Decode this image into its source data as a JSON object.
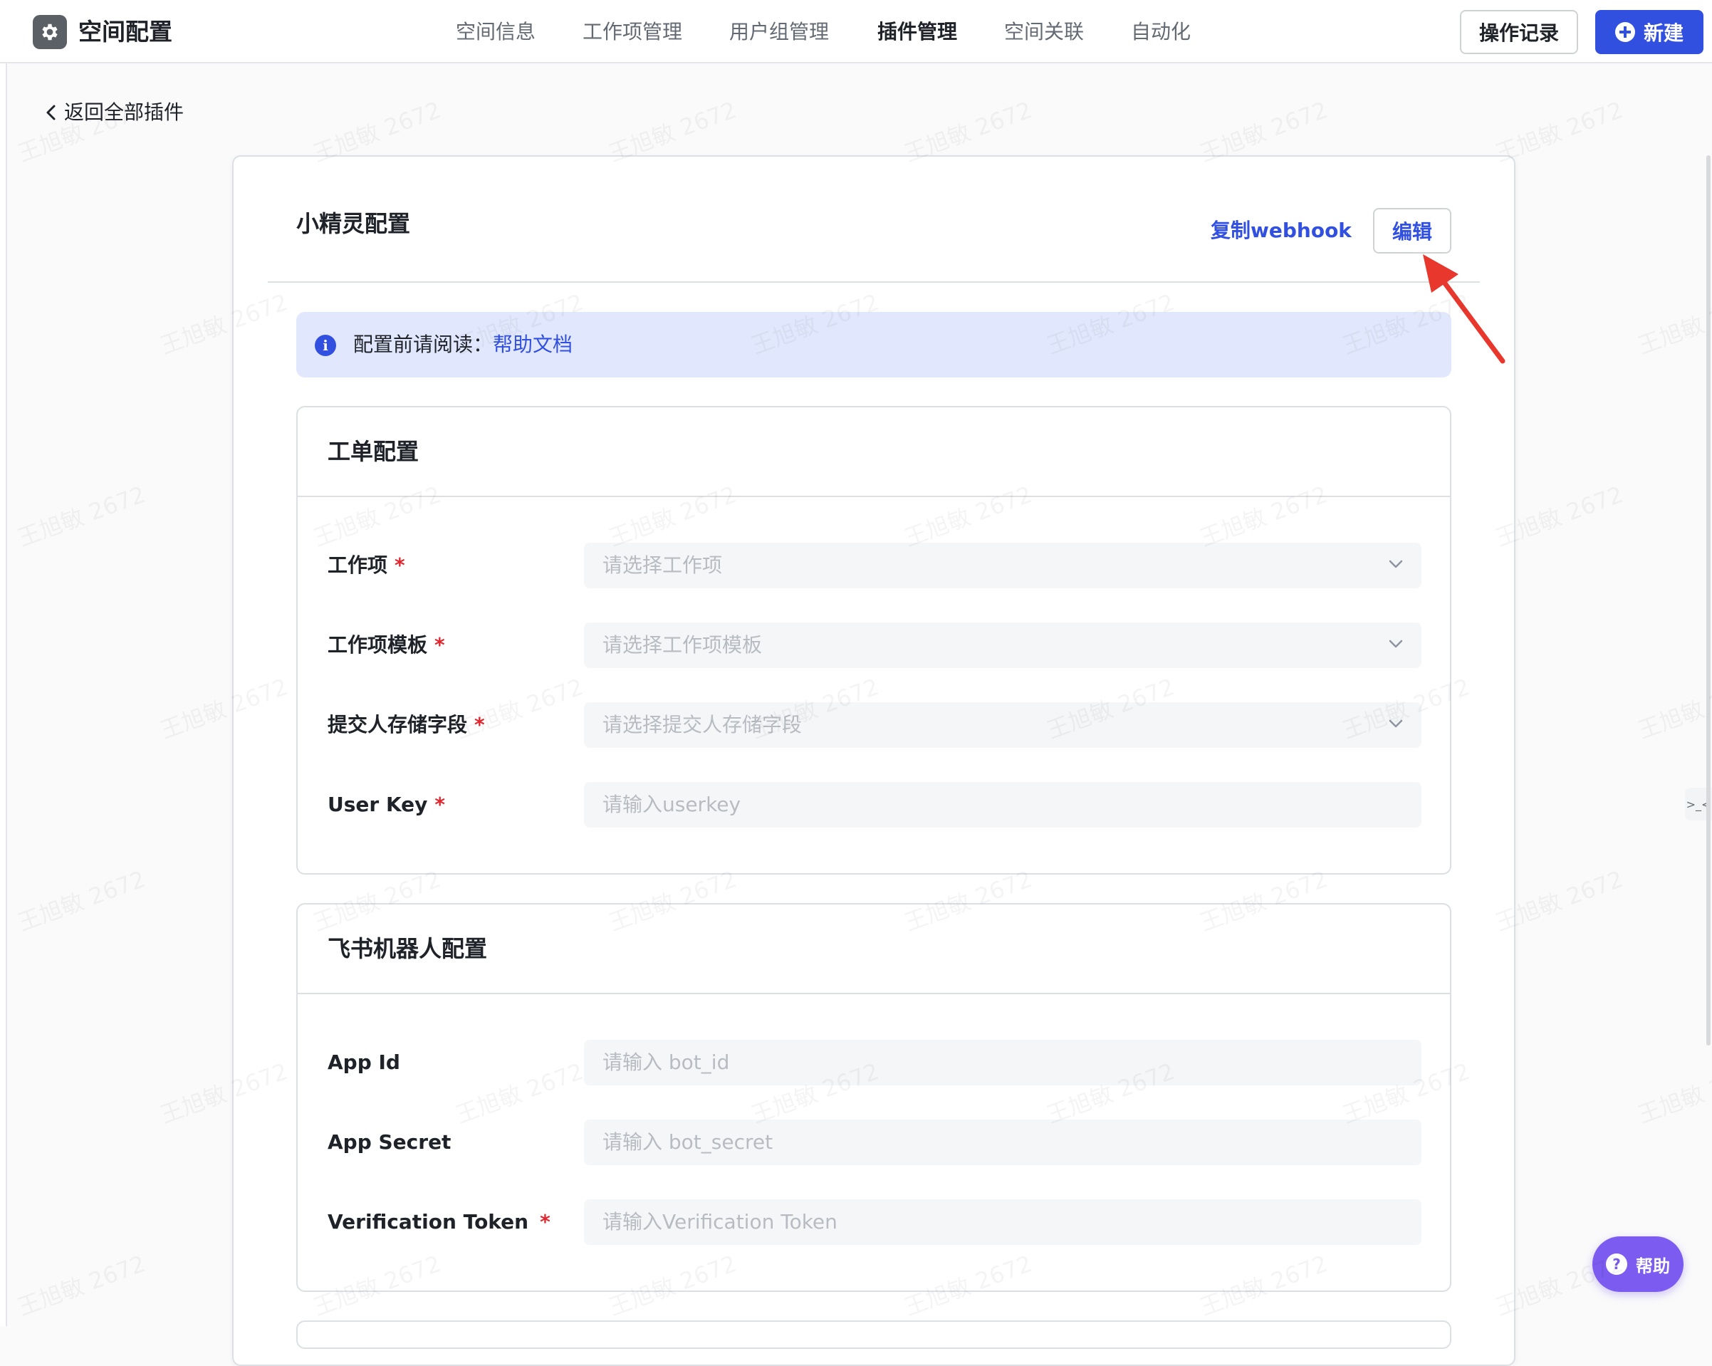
{
  "app": {
    "title": "空间配置",
    "icon": "gear-icon"
  },
  "nav": {
    "tabs": [
      {
        "label": "空间信息",
        "active": false
      },
      {
        "label": "工作项管理",
        "active": false
      },
      {
        "label": "用户组管理",
        "active": false
      },
      {
        "label": "插件管理",
        "active": true
      },
      {
        "label": "空间关联",
        "active": false
      },
      {
        "label": "自动化",
        "active": false
      }
    ]
  },
  "header_actions": {
    "log_label": "操作记录",
    "new_label": "新建"
  },
  "back_link": "返回全部插件",
  "card": {
    "title": "小精灵配置",
    "copy_webhook": "复制webhook",
    "edit": "编辑"
  },
  "notice": {
    "prefix": "配置前请阅读：",
    "link": "帮助文档"
  },
  "sections": {
    "ticket": {
      "title": "工单配置",
      "fields": [
        {
          "label": "工作项",
          "required": true,
          "placeholder": "请选择工作项",
          "type": "select"
        },
        {
          "label": "工作项模板",
          "required": true,
          "placeholder": "请选择工作项模板",
          "type": "select"
        },
        {
          "label": "提交人存储字段",
          "required": true,
          "placeholder": "请选择提交人存储字段",
          "type": "select"
        },
        {
          "label": "User Key",
          "required": true,
          "placeholder": "请输入userkey",
          "type": "input"
        }
      ]
    },
    "bot": {
      "title": "飞书机器人配置",
      "fields": [
        {
          "label": "App Id",
          "required": false,
          "placeholder": "请输入 bot_id",
          "type": "input"
        },
        {
          "label": "App Secret",
          "required": false,
          "placeholder": "请输入 bot_secret",
          "type": "input"
        },
        {
          "label": "Verification Token",
          "required": true,
          "placeholder": "请输入Verification Token",
          "type": "input"
        }
      ]
    }
  },
  "required_mark": "*",
  "help_button": "帮助",
  "side_widget": ">_<",
  "watermark": "王旭敏 2672",
  "colors": {
    "primary": "#3250e0",
    "notice_bg": "#e1e8fd",
    "required": "#e0272f",
    "help_button": "#7b5bf0",
    "arrow": "#e8372d"
  }
}
